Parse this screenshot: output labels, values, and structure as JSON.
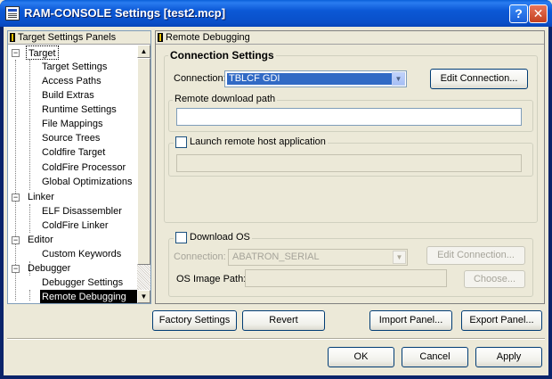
{
  "window": {
    "title": "RAM-CONSOLE Settings [test2.mcp]",
    "help_glyph": "?",
    "close_glyph": "✕"
  },
  "tree": {
    "header": "Target Settings Panels",
    "items": [
      {
        "label": "Target",
        "level": 0
      },
      {
        "label": "Target Settings",
        "level": 1
      },
      {
        "label": "Access Paths",
        "level": 1
      },
      {
        "label": "Build Extras",
        "level": 1
      },
      {
        "label": "Runtime Settings",
        "level": 1
      },
      {
        "label": "File Mappings",
        "level": 1
      },
      {
        "label": "Source Trees",
        "level": 1
      },
      {
        "label": "Coldfire Target",
        "level": 1
      },
      {
        "label": "ColdFire Processor",
        "level": 1
      },
      {
        "label": "Global Optimizations",
        "level": 1
      },
      {
        "label": "Linker",
        "level": 0
      },
      {
        "label": "ELF Disassembler",
        "level": 1
      },
      {
        "label": "ColdFire Linker",
        "level": 1
      },
      {
        "label": "Editor",
        "level": 0
      },
      {
        "label": "Custom Keywords",
        "level": 1
      },
      {
        "label": "Debugger",
        "level": 0
      },
      {
        "label": "Debugger Settings",
        "level": 1
      },
      {
        "label": "Remote Debugging",
        "level": 1,
        "selected": true
      }
    ]
  },
  "panel": {
    "header": "Remote Debugging",
    "connection_settings": {
      "title": "Connection Settings",
      "connection_label": "Connection:",
      "connection_value": "TBLCF GDI",
      "edit_connection": "Edit Connection...",
      "remote_download_label": "Remote download path",
      "remote_download_value": "",
      "launch_label": "Launch remote host application",
      "launch_checked": false,
      "launch_value": ""
    },
    "download_os": {
      "label": "Download OS",
      "checked": false,
      "connection_label": "Connection:",
      "connection_value": "ABATRON_SERIAL",
      "edit_connection": "Edit Connection...",
      "image_path_label": "OS Image Path:",
      "image_path_value": "",
      "choose": "Choose..."
    }
  },
  "buttons": {
    "factory_settings": "Factory Settings",
    "revert": "Revert",
    "import_panel": "Import Panel...",
    "export_panel": "Export Panel...",
    "ok": "OK",
    "cancel": "Cancel",
    "apply": "Apply"
  },
  "icons": {
    "scroll_up": "▲",
    "scroll_down": "▼",
    "dropdown": "▼",
    "expander": "−"
  },
  "colors": {
    "titlebar": "#0b58d6",
    "selection": "#000000",
    "connection_highlight": "#316ac5"
  }
}
